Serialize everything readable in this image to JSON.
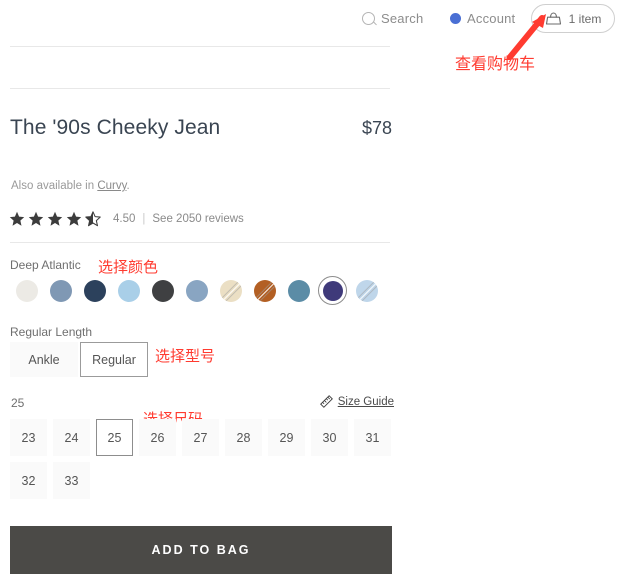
{
  "header": {
    "search_label": "Search",
    "search_icon": "search-icon",
    "account_label": "Account",
    "account_icon": "account-dot-icon",
    "cart_label": "1 item",
    "cart_icon": "shopping-bag-icon",
    "account_dot_color": "#4a6fd4"
  },
  "annotations": {
    "cart": "查看购物车",
    "color": "选择颜色",
    "length": "选择型号",
    "size": "选择尺码",
    "arrow_color": "#ff3b30"
  },
  "product": {
    "title": "The '90s Cheeky Jean",
    "price": "$78",
    "also_available_prefix": "Also available in ",
    "also_available_link": "Curvy",
    "also_available_suffix": "."
  },
  "rating": {
    "value": "4.50",
    "separator": "|",
    "reviews_label": "See 2050 reviews",
    "stars_full": 4,
    "stars_half": 1,
    "stars_total": 5,
    "star_color": "#3c3c3c"
  },
  "color": {
    "selected_name": "Deep Atlantic",
    "swatches": [
      {
        "name": "off-white",
        "hex": "#eceae5",
        "sold_out": false,
        "selected": false
      },
      {
        "name": "steel-blue",
        "hex": "#7f98b4",
        "sold_out": false,
        "selected": false
      },
      {
        "name": "dark-navy",
        "hex": "#2c415c",
        "sold_out": false,
        "selected": false
      },
      {
        "name": "light-blue",
        "hex": "#a9cfe8",
        "sold_out": false,
        "selected": false
      },
      {
        "name": "charcoal",
        "hex": "#3f4042",
        "sold_out": false,
        "selected": false
      },
      {
        "name": "dusty-blue",
        "hex": "#89a5c2",
        "sold_out": false,
        "selected": false
      },
      {
        "name": "cream",
        "hex": "#ebdfc4",
        "sold_out": true,
        "selected": false
      },
      {
        "name": "rust",
        "hex": "#b35f23",
        "sold_out": true,
        "selected": false
      },
      {
        "name": "teal-blue",
        "hex": "#5b8ca6",
        "sold_out": false,
        "selected": false
      },
      {
        "name": "deep-atlantic",
        "hex": "#3f3a7a",
        "sold_out": false,
        "selected": true
      },
      {
        "name": "pale-blue",
        "hex": "#bfd6ea",
        "sold_out": true,
        "selected": false
      }
    ]
  },
  "length": {
    "label": "Regular Length",
    "options": [
      {
        "label": "Ankle",
        "selected": false
      },
      {
        "label": "Regular",
        "selected": true
      }
    ]
  },
  "size": {
    "selected": "25",
    "size_guide_label": "Size Guide",
    "size_guide_icon": "ruler-icon",
    "options": [
      {
        "label": "23",
        "selected": false
      },
      {
        "label": "24",
        "selected": false
      },
      {
        "label": "25",
        "selected": true
      },
      {
        "label": "26",
        "selected": false
      },
      {
        "label": "27",
        "selected": false
      },
      {
        "label": "28",
        "selected": false
      },
      {
        "label": "29",
        "selected": false
      },
      {
        "label": "30",
        "selected": false
      },
      {
        "label": "31",
        "selected": false
      },
      {
        "label": "32",
        "selected": false
      },
      {
        "label": "33",
        "selected": false
      }
    ]
  },
  "cta": {
    "add_to_bag_label": "ADD TO BAG",
    "background": "#4b4a47"
  }
}
